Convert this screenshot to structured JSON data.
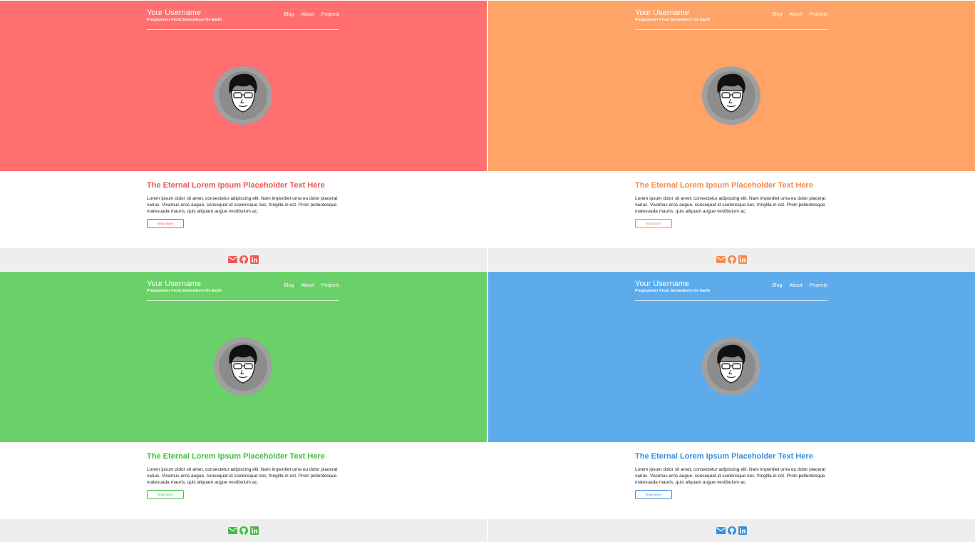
{
  "site": {
    "username": "Your Username",
    "tagline": "Programmer From Somewhere On Earth",
    "nav": [
      "Blog",
      "About",
      "Projects"
    ]
  },
  "post": {
    "title": "The Eternal Lorem Ipsum Placeholder Text Here",
    "body": "Lorem ipsum dolor sit amet, consectetur adipiscing elit. Nam imperdiet urna eu dolor placerat varius. Vivamus eros augue, consequat id scelerisque nec, fringilla in est. Proin pellentesque malesuada mauris, quis aliquam augue vestibulum ac.",
    "read_more": "Read More"
  },
  "footer": {
    "icons": [
      "envelope-icon",
      "github-icon",
      "linkedin-icon"
    ],
    "background": "#eeeeee"
  },
  "themes": [
    {
      "name": "red",
      "hero": "#ff6f6f",
      "accent": "#f25555"
    },
    {
      "name": "orange",
      "hero": "#ffa366",
      "accent": "#f6894b"
    },
    {
      "name": "green",
      "hero": "#6ad068",
      "accent": "#45bb43"
    },
    {
      "name": "blue",
      "hero": "#5dabeb",
      "accent": "#3a8fdb"
    }
  ],
  "avatar": {
    "ring": "#a0a0a0",
    "face": "#ffffff",
    "hair": "#111111"
  }
}
